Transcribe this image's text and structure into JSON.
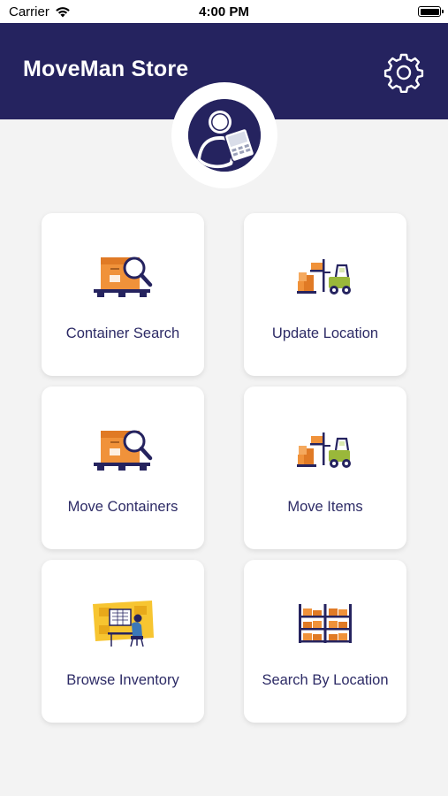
{
  "status_bar": {
    "carrier": "Carrier",
    "time": "4:00 PM"
  },
  "header": {
    "title": "MoveMan Store",
    "background_color": "#25235f",
    "settings_icon": "gear-icon",
    "avatar_icon": "user-with-badge-icon"
  },
  "tiles": [
    {
      "label": "Container Search",
      "icon": "box-magnifier-icon"
    },
    {
      "label": "Update Location",
      "icon": "forklift-icon"
    },
    {
      "label": "Move Containers",
      "icon": "box-magnifier-icon"
    },
    {
      "label": "Move Items",
      "icon": "forklift-icon"
    },
    {
      "label": "Browse Inventory",
      "icon": "worker-at-desk-icon"
    },
    {
      "label": "Search By Location",
      "icon": "warehouse-shelf-icon"
    }
  ],
  "colors": {
    "accent": "#25235f",
    "label_text": "#2d2b66",
    "page_background": "#f3f3f3",
    "box_orange": "#f0923a"
  }
}
